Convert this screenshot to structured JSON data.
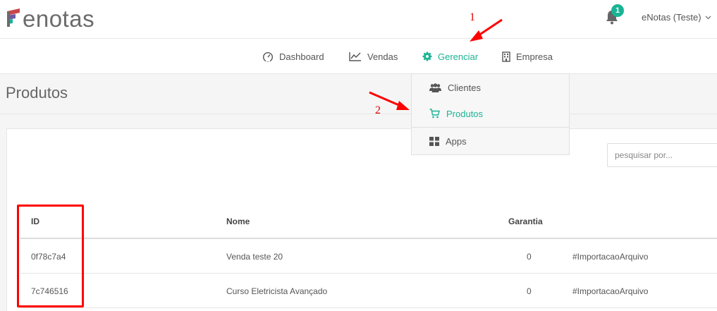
{
  "app": {
    "logo_text": "enotas",
    "brand_color": "#19b394"
  },
  "header": {
    "notification_count": "1",
    "user_label": "eNotas (Teste)"
  },
  "nav": {
    "items": [
      {
        "label": "Dashboard",
        "icon": "dashboard-gauge-icon"
      },
      {
        "label": "Vendas",
        "icon": "line-chart-icon"
      },
      {
        "label": "Gerenciar",
        "icon": "gear-icon",
        "active": true
      },
      {
        "label": "Empresa",
        "icon": "building-icon"
      }
    ]
  },
  "dropdown": {
    "items": [
      {
        "label": "Clientes",
        "icon": "users-icon"
      },
      {
        "label": "Produtos",
        "icon": "shopping-cart-icon",
        "active": true
      },
      {
        "label": "Apps",
        "icon": "grid-icon"
      }
    ]
  },
  "page": {
    "title": "Produtos"
  },
  "search": {
    "placeholder": "pesquisar por..."
  },
  "table": {
    "headers": {
      "id": "ID",
      "nome": "Nome",
      "garantia": "Garantia"
    },
    "rows": [
      {
        "id": "0f78c7a4",
        "nome": "Venda teste 20",
        "garantia": "0",
        "tag": "#ImportacaoArquivo"
      },
      {
        "id": "7c746516",
        "nome": "Curso Eletricista Avançado",
        "garantia": "0",
        "tag": "#ImportacaoArquivo"
      }
    ]
  },
  "annotations": {
    "step1": "1",
    "step2": "2"
  }
}
